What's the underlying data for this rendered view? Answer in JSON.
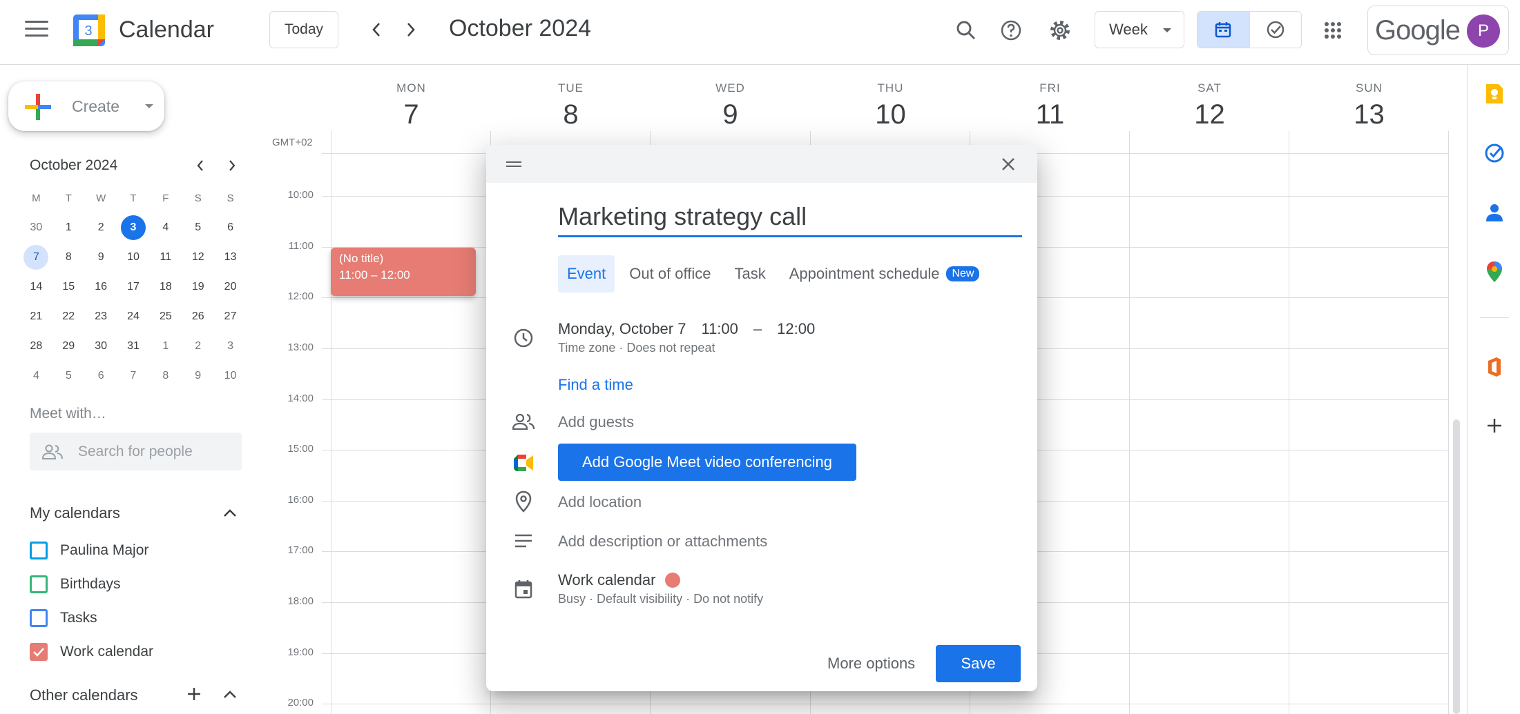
{
  "app": {
    "title": "Calendar",
    "logo_number": "3"
  },
  "toolbar": {
    "today_label": "Today",
    "period_label": "October 2024",
    "view_label": "Week",
    "google_label": "Google",
    "avatar_initial": "P"
  },
  "colors": {
    "accent": "#1a73e8",
    "event_color": "#e67c73",
    "paulina_color": "#039be5",
    "birthdays_color": "#33b679",
    "tasks_color": "#4285f4",
    "work_color": "#e67c73"
  },
  "sidebar": {
    "create_label": "Create",
    "mini_calendar": {
      "title": "October 2024",
      "weekday_headers": [
        "M",
        "T",
        "W",
        "T",
        "F",
        "S",
        "S"
      ],
      "weeks": [
        [
          "30",
          "1",
          "2",
          "3",
          "4",
          "5",
          "6"
        ],
        [
          "7",
          "8",
          "9",
          "10",
          "11",
          "12",
          "13"
        ],
        [
          "14",
          "15",
          "16",
          "17",
          "18",
          "19",
          "20"
        ],
        [
          "21",
          "22",
          "23",
          "24",
          "25",
          "26",
          "27"
        ],
        [
          "28",
          "29",
          "30",
          "31",
          "1",
          "2",
          "3"
        ],
        [
          "4",
          "5",
          "6",
          "7",
          "8",
          "9",
          "10"
        ]
      ]
    },
    "meet_title": "Meet with…",
    "search_people_placeholder": "Search for people",
    "my_calendars_title": "My calendars",
    "calendars": [
      {
        "name": "Paulina Major",
        "checked": false
      },
      {
        "name": "Birthdays",
        "checked": false
      },
      {
        "name": "Tasks",
        "checked": false
      },
      {
        "name": "Work calendar",
        "checked": true
      }
    ],
    "other_calendars_title": "Other calendars"
  },
  "week": {
    "timezone_label": "GMT+02",
    "days": [
      {
        "dow": "MON",
        "num": "7"
      },
      {
        "dow": "TUE",
        "num": "8"
      },
      {
        "dow": "WED",
        "num": "9"
      },
      {
        "dow": "THU",
        "num": "10"
      },
      {
        "dow": "FRI",
        "num": "11"
      },
      {
        "dow": "SAT",
        "num": "12"
      },
      {
        "dow": "SUN",
        "num": "13"
      }
    ],
    "hours": [
      "10:00",
      "11:00",
      "12:00",
      "13:00",
      "14:00",
      "15:00",
      "16:00",
      "17:00",
      "18:00",
      "19:00",
      "20:00"
    ],
    "event": {
      "title": "(No title)",
      "range": "11:00 – 12:00"
    }
  },
  "dialog": {
    "title_value": "Marketing strategy call",
    "tabs": [
      "Event",
      "Out of office",
      "Task",
      "Appointment schedule"
    ],
    "new_badge": "New",
    "date": "Monday, October 7",
    "start": "11:00",
    "dash": "–",
    "end": "12:00",
    "sub_timezone": "Time zone",
    "sub_repeat": "Does not repeat",
    "find_time": "Find a time",
    "add_guests": "Add guests",
    "meet_button": "Add Google Meet video conferencing",
    "add_location": "Add location",
    "add_description": "Add description or attachments",
    "calendar_name": "Work calendar",
    "busy": "Busy",
    "visibility": "Default visibility",
    "notify": "Do not notify",
    "more_options": "More options",
    "save": "Save"
  }
}
